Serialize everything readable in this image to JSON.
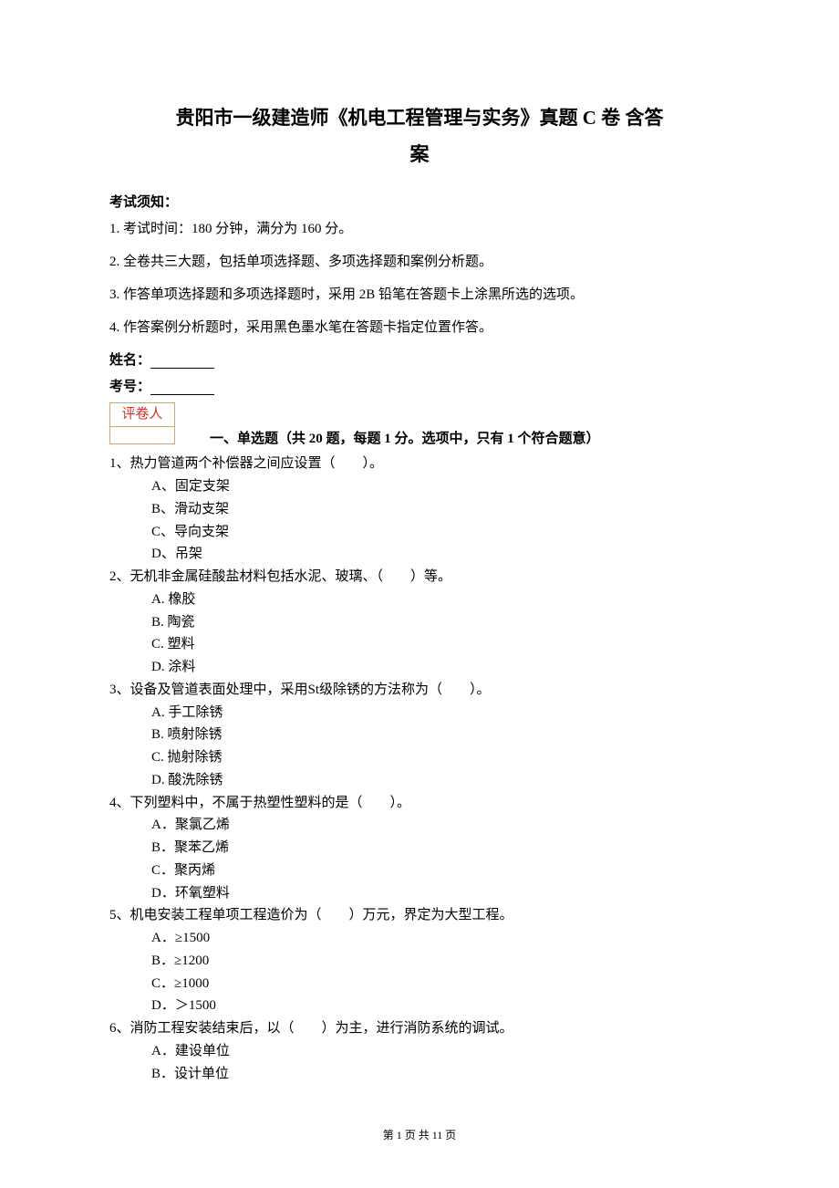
{
  "title_line1": "贵阳市一级建造师《机电工程管理与实务》真题 C 卷 含答",
  "title_line2": "案",
  "notice_heading": "考试须知：",
  "notices": [
    "1. 考试时间：180 分钟，满分为 160 分。",
    "2. 全卷共三大题，包括单项选择题、多项选择题和案例分析题。",
    "3. 作答单项选择题和多项选择题时，采用 2B 铅笔在答题卡上涂黑所选的选项。",
    "4. 作答案例分析题时，采用黑色墨水笔在答题卡指定位置作答。"
  ],
  "name_label": "姓名：",
  "exam_no_label": "考号：",
  "grader_label": "评卷人",
  "section1_header": "一、单选题（共 20 题，每题 1 分。选项中，只有 1 个符合题意）",
  "questions": [
    {
      "num": "1、",
      "text": "热力管道两个补偿器之间应设置（　　）。",
      "options": [
        "A、固定支架",
        "B、滑动支架",
        "C、导向支架",
        "D、吊架"
      ]
    },
    {
      "num": "2、",
      "text": "无机非金属硅酸盐材料包括水泥、玻璃、（　　）等。",
      "options": [
        "A. 橡胶",
        "B. 陶瓷",
        "C. 塑料",
        "D. 涂料"
      ]
    },
    {
      "num": "3、",
      "text": "设备及管道表面处理中，采用St级除锈的方法称为（　　）。",
      "options": [
        "A. 手工除锈",
        "B. 喷射除锈",
        "C. 抛射除锈",
        "D. 酸洗除锈"
      ]
    },
    {
      "num": "4、",
      "text": "下列塑料中，不属于热塑性塑料的是（　　）。",
      "options": [
        "A．聚氯乙烯",
        "B．聚苯乙烯",
        "C．聚丙烯",
        "D．环氧塑料"
      ]
    },
    {
      "num": "5、",
      "text": "机电安装工程单项工程造价为（　　）万元，界定为大型工程。",
      "options": [
        "A．≥1500",
        "B．≥1200",
        "C．≥1000",
        "D．＞1500"
      ]
    },
    {
      "num": "6、",
      "text": "消防工程安装结束后，以（　　）为主，进行消防系统的调试。",
      "options": [
        "A．建设单位",
        "B．设计单位"
      ]
    }
  ],
  "footer": "第 1 页 共 11 页"
}
